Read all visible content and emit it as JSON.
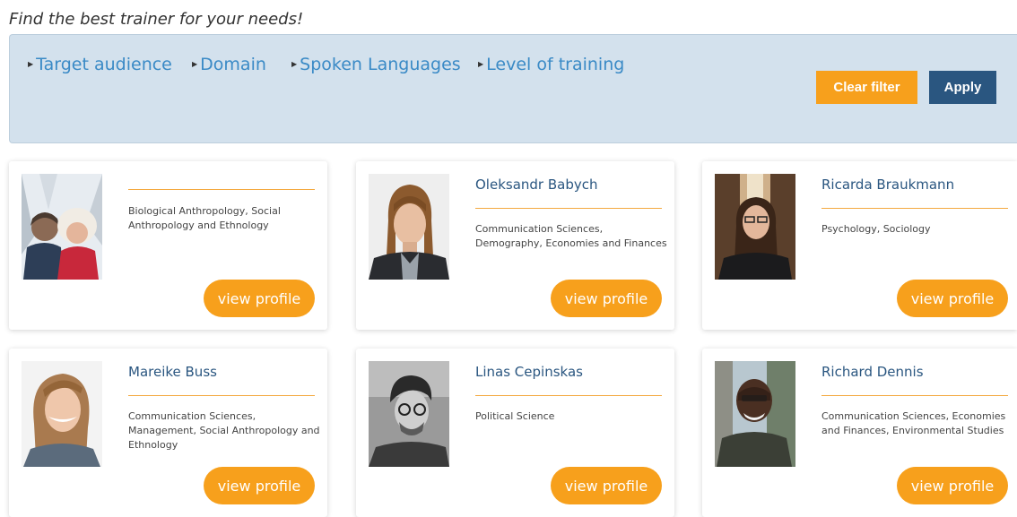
{
  "page": {
    "heading": "Find the best trainer for your needs!"
  },
  "filters": {
    "items": [
      "Target audience",
      "Domain",
      "Spoken Languages",
      "Level of training"
    ],
    "clear_label": "Clear filter",
    "apply_label": "Apply"
  },
  "trainers": [
    {
      "name": "",
      "domains": "Biological Anthropology, Social Anthropology and Ethnology",
      "button": "view profile"
    },
    {
      "name": "Oleksandr Babych",
      "domains": "Communication Sciences, Demography, Economies and Finances",
      "button": "view profile"
    },
    {
      "name": "Ricarda Braukmann",
      "domains": "Psychology, Sociology",
      "button": "view profile"
    },
    {
      "name": "Mareike Buss",
      "domains": "Communication Sciences, Management, Social Anthropology and Ethnology",
      "button": "view profile"
    },
    {
      "name": "Linas Cepinskas",
      "domains": "Political Science",
      "button": "view profile"
    },
    {
      "name": "Richard Dennis",
      "domains": "Communication Sciences, Economies and Finances, Environmental Studies",
      "button": "view profile"
    }
  ],
  "colors": {
    "accent": "#f7a01c",
    "brand": "#2a5680",
    "link": "#3a8ac6",
    "panel": "#d3e1ed"
  }
}
